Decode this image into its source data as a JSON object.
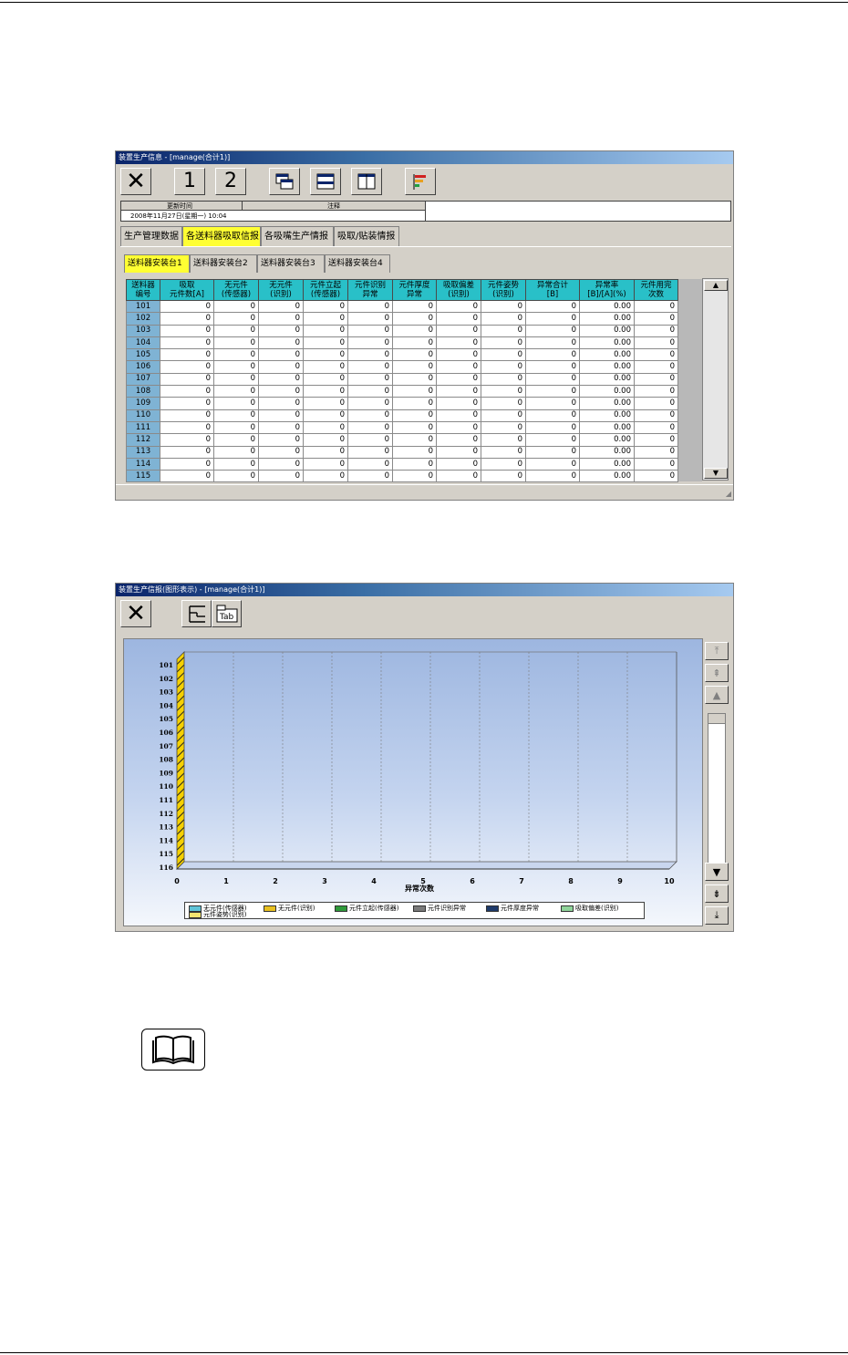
{
  "window1": {
    "title": "装置生产信息 - [manage(合计1)]",
    "toolbar": {
      "close": "✕",
      "btn1": "1",
      "btn2": "2"
    },
    "stamp": {
      "header_time": "更新时间",
      "header_note": "注释",
      "time_value": "2008年11月27日(星期一) 10:04"
    },
    "tabs": [
      "生产管理数据",
      "各送料器吸取信报",
      "各吸嘴生产情报",
      "吸取/贴装情报"
    ],
    "active_tab": 1,
    "subtabs": [
      "送料器安装台1",
      "送料器安装台2",
      "送料器安装台3",
      "送料器安装台4"
    ],
    "active_subtab": 0,
    "columns": [
      [
        "送料器",
        "编号"
      ],
      [
        "吸取",
        "元件数[A]"
      ],
      [
        "无元件",
        "(传感器)"
      ],
      [
        "无元件",
        "(识别)"
      ],
      [
        "元件立起",
        "(传感器)"
      ],
      [
        "元件识别",
        "异常"
      ],
      [
        "元件厚度",
        "异常"
      ],
      [
        "吸取偏差",
        "(识别)"
      ],
      [
        "元件姿势",
        "(识别)"
      ],
      [
        "异常合计",
        "[B]"
      ],
      [
        "异常率",
        "[B]/[A](%)"
      ],
      [
        "元件用完",
        "次数"
      ]
    ],
    "rows": [
      [
        "101",
        "0",
        "0",
        "0",
        "0",
        "0",
        "0",
        "0",
        "0",
        "0",
        "0.00",
        "0"
      ],
      [
        "102",
        "0",
        "0",
        "0",
        "0",
        "0",
        "0",
        "0",
        "0",
        "0",
        "0.00",
        "0"
      ],
      [
        "103",
        "0",
        "0",
        "0",
        "0",
        "0",
        "0",
        "0",
        "0",
        "0",
        "0.00",
        "0"
      ],
      [
        "104",
        "0",
        "0",
        "0",
        "0",
        "0",
        "0",
        "0",
        "0",
        "0",
        "0.00",
        "0"
      ],
      [
        "105",
        "0",
        "0",
        "0",
        "0",
        "0",
        "0",
        "0",
        "0",
        "0",
        "0.00",
        "0"
      ],
      [
        "106",
        "0",
        "0",
        "0",
        "0",
        "0",
        "0",
        "0",
        "0",
        "0",
        "0.00",
        "0"
      ],
      [
        "107",
        "0",
        "0",
        "0",
        "0",
        "0",
        "0",
        "0",
        "0",
        "0",
        "0.00",
        "0"
      ],
      [
        "108",
        "0",
        "0",
        "0",
        "0",
        "0",
        "0",
        "0",
        "0",
        "0",
        "0.00",
        "0"
      ],
      [
        "109",
        "0",
        "0",
        "0",
        "0",
        "0",
        "0",
        "0",
        "0",
        "0",
        "0.00",
        "0"
      ],
      [
        "110",
        "0",
        "0",
        "0",
        "0",
        "0",
        "0",
        "0",
        "0",
        "0",
        "0.00",
        "0"
      ],
      [
        "111",
        "0",
        "0",
        "0",
        "0",
        "0",
        "0",
        "0",
        "0",
        "0",
        "0.00",
        "0"
      ],
      [
        "112",
        "0",
        "0",
        "0",
        "0",
        "0",
        "0",
        "0",
        "0",
        "0",
        "0.00",
        "0"
      ],
      [
        "113",
        "0",
        "0",
        "0",
        "0",
        "0",
        "0",
        "0",
        "0",
        "0",
        "0.00",
        "0"
      ],
      [
        "114",
        "0",
        "0",
        "0",
        "0",
        "0",
        "0",
        "0",
        "0",
        "0",
        "0.00",
        "0"
      ],
      [
        "115",
        "0",
        "0",
        "0",
        "0",
        "0",
        "0",
        "0",
        "0",
        "0",
        "0.00",
        "0"
      ]
    ]
  },
  "window2": {
    "title": "装置生产信报(图形表示) - [manage(合计1)]",
    "toolbar": {
      "close": "✕",
      "tab_icon_text": "Tab"
    },
    "chart_data": {
      "type": "bar",
      "orientation": "horizontal",
      "categories": [
        "101",
        "102",
        "103",
        "104",
        "105",
        "106",
        "107",
        "108",
        "109",
        "110",
        "111",
        "112",
        "113",
        "114",
        "115",
        "116"
      ],
      "xlabel": "异常次数",
      "xlim": [
        0,
        10
      ],
      "xticks": [
        "0",
        "1",
        "2",
        "3",
        "4",
        "5",
        "6",
        "7",
        "8",
        "9",
        "10"
      ],
      "series": [
        {
          "name": "无元件(传感器)",
          "color": "#5fc4d8",
          "values": [
            0,
            0,
            0,
            0,
            0,
            0,
            0,
            0,
            0,
            0,
            0,
            0,
            0,
            0,
            0,
            0
          ]
        },
        {
          "name": "无元件(识别)",
          "color": "#e8c020",
          "values": [
            0,
            0,
            0,
            0,
            0,
            0,
            0,
            0,
            0,
            0,
            0,
            0,
            0,
            0,
            0,
            0
          ]
        },
        {
          "name": "元件立起(传感器)",
          "color": "#2f9a3a",
          "values": [
            0,
            0,
            0,
            0,
            0,
            0,
            0,
            0,
            0,
            0,
            0,
            0,
            0,
            0,
            0,
            0
          ]
        },
        {
          "name": "元件识别异常",
          "color": "#7a7a7a",
          "values": [
            0,
            0,
            0,
            0,
            0,
            0,
            0,
            0,
            0,
            0,
            0,
            0,
            0,
            0,
            0,
            0
          ]
        },
        {
          "name": "元件厚度异常",
          "color": "#1e3a6a",
          "values": [
            0,
            0,
            0,
            0,
            0,
            0,
            0,
            0,
            0,
            0,
            0,
            0,
            0,
            0,
            0,
            0
          ]
        },
        {
          "name": "吸取偏差(识别)",
          "color": "#8fd49a",
          "values": [
            0,
            0,
            0,
            0,
            0,
            0,
            0,
            0,
            0,
            0,
            0,
            0,
            0,
            0,
            0,
            0
          ]
        },
        {
          "name": "元件姿势(识别)",
          "color": "#f3e470",
          "values": [
            0,
            0,
            0,
            0,
            0,
            0,
            0,
            0,
            0,
            0,
            0,
            0,
            0,
            0,
            0,
            0
          ]
        }
      ],
      "grid": true,
      "legend_position": "bottom"
    },
    "side_buttons": [
      "⤒",
      "⇞",
      "▲",
      "▼",
      "⇟",
      "⤓"
    ]
  }
}
